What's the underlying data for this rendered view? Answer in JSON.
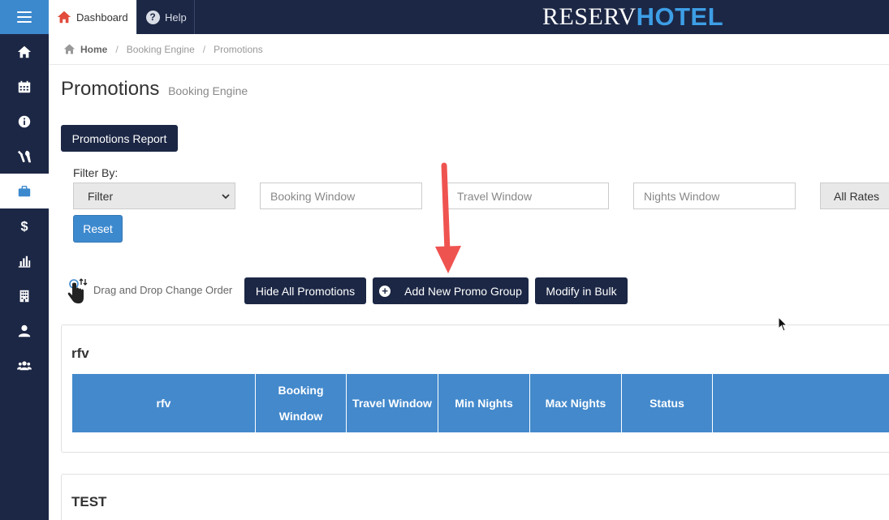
{
  "topbar": {
    "tabs": [
      {
        "label": "Dashboard",
        "icon": "home-icon"
      },
      {
        "label": "Help",
        "icon": "help-icon"
      }
    ],
    "logo": {
      "part1": "RESERV",
      "part2": "HOTEL"
    }
  },
  "sidebar": {
    "items": [
      {
        "icon": "home-icon",
        "active": false
      },
      {
        "icon": "calendar-icon",
        "active": false
      },
      {
        "icon": "info-icon",
        "active": false
      },
      {
        "icon": "tools-icon",
        "active": false
      },
      {
        "icon": "briefcase-icon",
        "active": true
      },
      {
        "icon": "dollar-icon",
        "active": false
      },
      {
        "icon": "bar-chart-icon",
        "active": false
      },
      {
        "icon": "building-icon",
        "active": false
      },
      {
        "icon": "user-icon",
        "active": false
      },
      {
        "icon": "users-icon",
        "active": false
      }
    ]
  },
  "breadcrumb": {
    "home": "Home",
    "items": [
      "Booking Engine",
      "Promotions"
    ],
    "separator": "/"
  },
  "page": {
    "title": "Promotions",
    "subtitle": "Booking Engine"
  },
  "buttons": {
    "report": "Promotions Report",
    "reset": "Reset",
    "hide_all": "Hide All Promotions",
    "add_group": "Add New Promo Group",
    "modify_bulk": "Modify in Bulk"
  },
  "filter": {
    "label": "Filter By:",
    "select_value": "Filter",
    "booking_placeholder": "Booking Window",
    "travel_placeholder": "Travel Window",
    "nights_placeholder": "Nights Window",
    "rates_value": "All Rates"
  },
  "drag": {
    "text": "Drag and Drop Change Order"
  },
  "groups": [
    {
      "name": "rfv",
      "columns": [
        "rfv",
        "Booking Window",
        "Travel Window",
        "Min Nights",
        "Max Nights",
        "Status",
        ""
      ]
    },
    {
      "name": "TEST"
    }
  ],
  "colors": {
    "navy": "#1c2745",
    "accent_blue": "#3d89ce",
    "table_header": "#4389cc",
    "annotation_arrow": "#ef5350"
  }
}
